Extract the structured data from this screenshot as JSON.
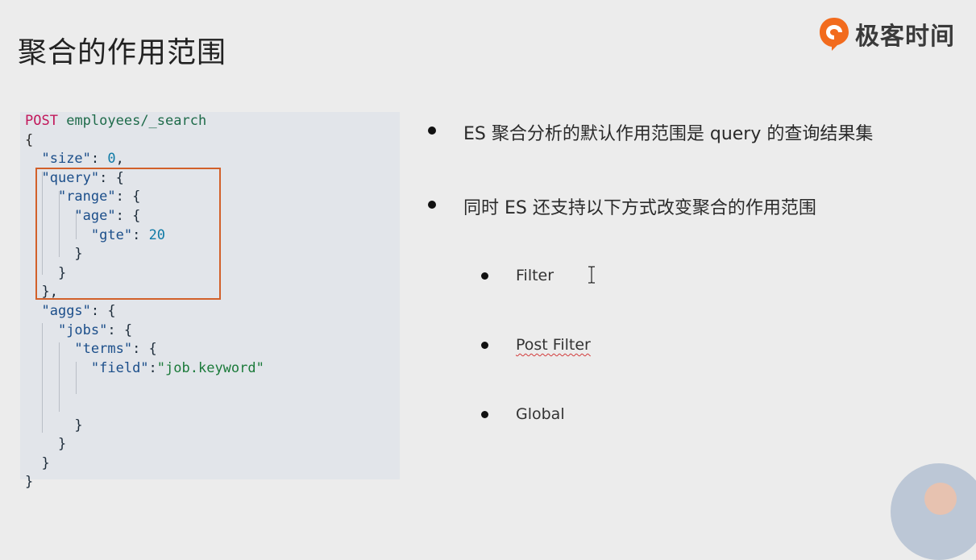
{
  "slide": {
    "title": "聚合的作用范围",
    "logo_text": "极客时间",
    "logo_icon": "geektime-logo-icon",
    "accent_color": "#d2602a"
  },
  "code": {
    "method": "POST",
    "path": "employees/_search",
    "lines": {
      "l_open": "{",
      "size_key": "\"size\"",
      "size_val": "0",
      "query_key": "\"query\"",
      "range_key": "\"range\"",
      "age_key": "\"age\"",
      "gte_key": "\"gte\"",
      "gte_val": "20",
      "aggs_key": "\"aggs\"",
      "jobs_key": "\"jobs\"",
      "terms_key": "\"terms\"",
      "field_key": "\"field\"",
      "field_val": "\"job.keyword\""
    }
  },
  "bullets": [
    {
      "text": "ES 聚合分析的默认作用范围是 query 的查询结果集"
    },
    {
      "text": "同时 ES 还支持以下方式改变聚合的作用范围"
    }
  ],
  "sub_bullets": [
    {
      "text": "Filter"
    },
    {
      "text": "Post Filter"
    },
    {
      "text": "Global"
    }
  ]
}
